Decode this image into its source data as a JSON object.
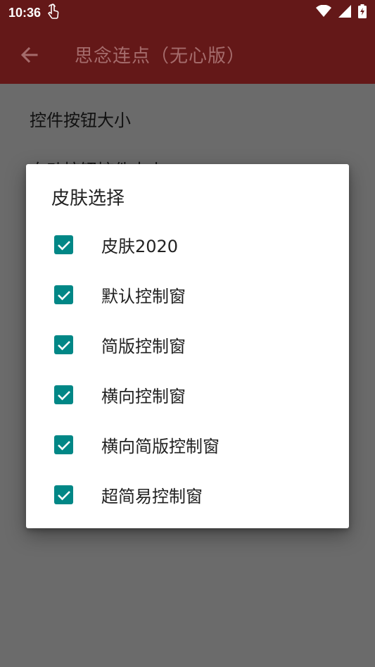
{
  "status_bar": {
    "time": "10:36",
    "icons": [
      "touch-hand-icon",
      "wifi-icon",
      "signal-icon",
      "battery-charging-icon"
    ]
  },
  "app_bar": {
    "back_icon": "arrow-left-icon",
    "title": "思念连点（无心版）"
  },
  "background_list": {
    "items": [
      "控件按钮大小",
      "自动按钮控件大小"
    ]
  },
  "dialog": {
    "title": "皮肤选择",
    "options": [
      {
        "label": "皮肤2020",
        "checked": true
      },
      {
        "label": "默认控制窗",
        "checked": true
      },
      {
        "label": "简版控制窗",
        "checked": true
      },
      {
        "label": "横向控制窗",
        "checked": true
      },
      {
        "label": "横向简版控制窗",
        "checked": true
      },
      {
        "label": "超简易控制窗",
        "checked": true
      }
    ]
  },
  "colors": {
    "primary_dark": "#641818",
    "checkbox": "#018786",
    "scrim": "#6b6b6b"
  }
}
